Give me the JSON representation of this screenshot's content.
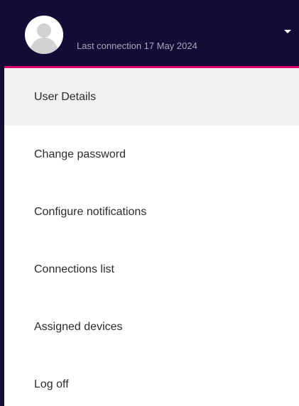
{
  "header": {
    "last_connection": "Last connection 17 May 2024",
    "avatar_icon": "user-avatar-icon",
    "dropdown_icon": "caret-down-icon",
    "colors": {
      "background": "#140b36",
      "accent": "#e4006f"
    }
  },
  "menu": {
    "items": [
      {
        "label": "User Details",
        "active": true
      },
      {
        "label": "Change password"
      },
      {
        "label": "Configure notifications"
      },
      {
        "label": "Connections list"
      },
      {
        "label": "Assigned devices"
      },
      {
        "label": "Log off"
      }
    ]
  }
}
